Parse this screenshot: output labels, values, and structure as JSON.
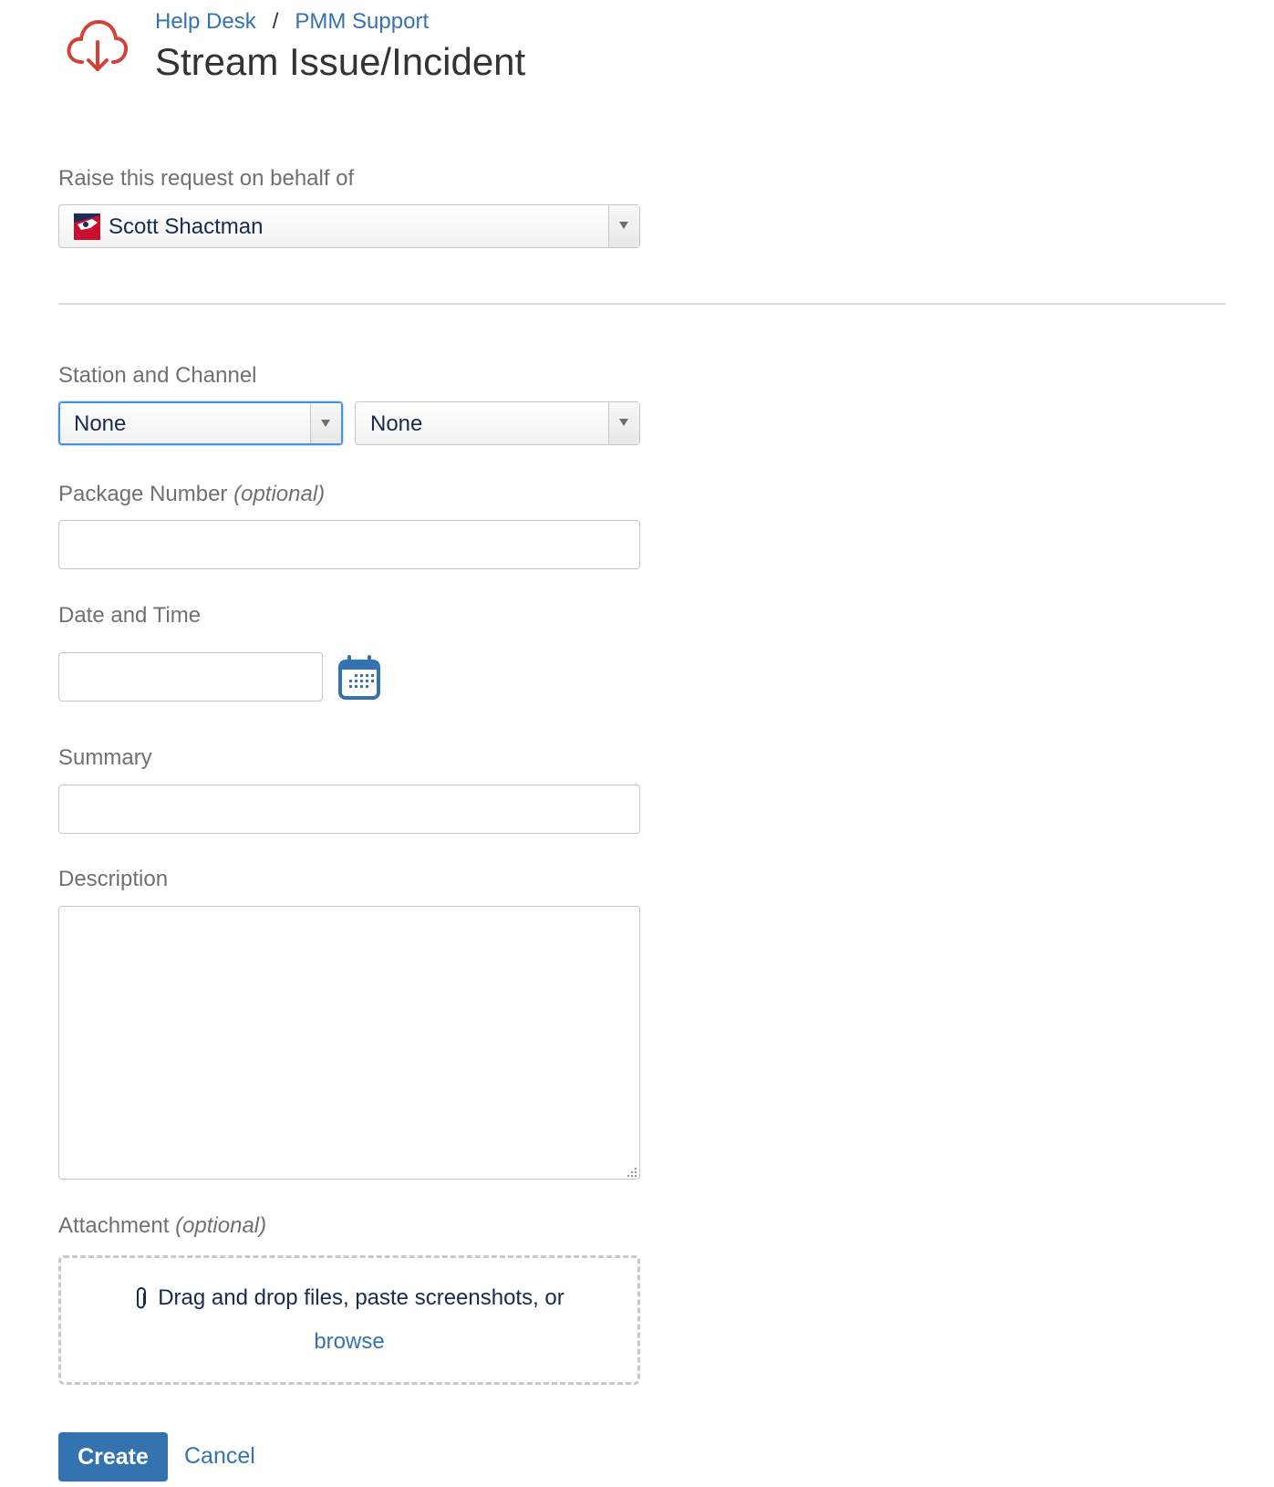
{
  "breadcrumb": {
    "item1": "Help Desk",
    "separator": "/",
    "item2": "PMM Support"
  },
  "page_title": "Stream Issue/Incident",
  "icons": {
    "logo": "cloud-download-icon",
    "calendar": "calendar-icon",
    "attachment": "paperclip-icon",
    "dropdown": "triangle-down-icon"
  },
  "colors": {
    "link": "#3572b0",
    "brand_logo": "#d04437",
    "primary_button": "#3572b0",
    "focus": "#4a90e2"
  },
  "form": {
    "on_behalf": {
      "label": "Raise this request on behalf of",
      "value": "Scott Shactman"
    },
    "station_channel": {
      "label": "Station and Channel",
      "station_value": "None",
      "channel_value": "None"
    },
    "package_number": {
      "label": "Package Number",
      "optional": "(optional)",
      "value": ""
    },
    "date_time": {
      "label": "Date and Time",
      "value": ""
    },
    "summary": {
      "label": "Summary",
      "value": ""
    },
    "description": {
      "label": "Description",
      "value": ""
    },
    "attachment": {
      "label": "Attachment",
      "optional": "(optional)",
      "drop_text": "Drag and drop files, paste screenshots, or",
      "browse": "browse"
    }
  },
  "actions": {
    "create": "Create",
    "cancel": "Cancel"
  }
}
